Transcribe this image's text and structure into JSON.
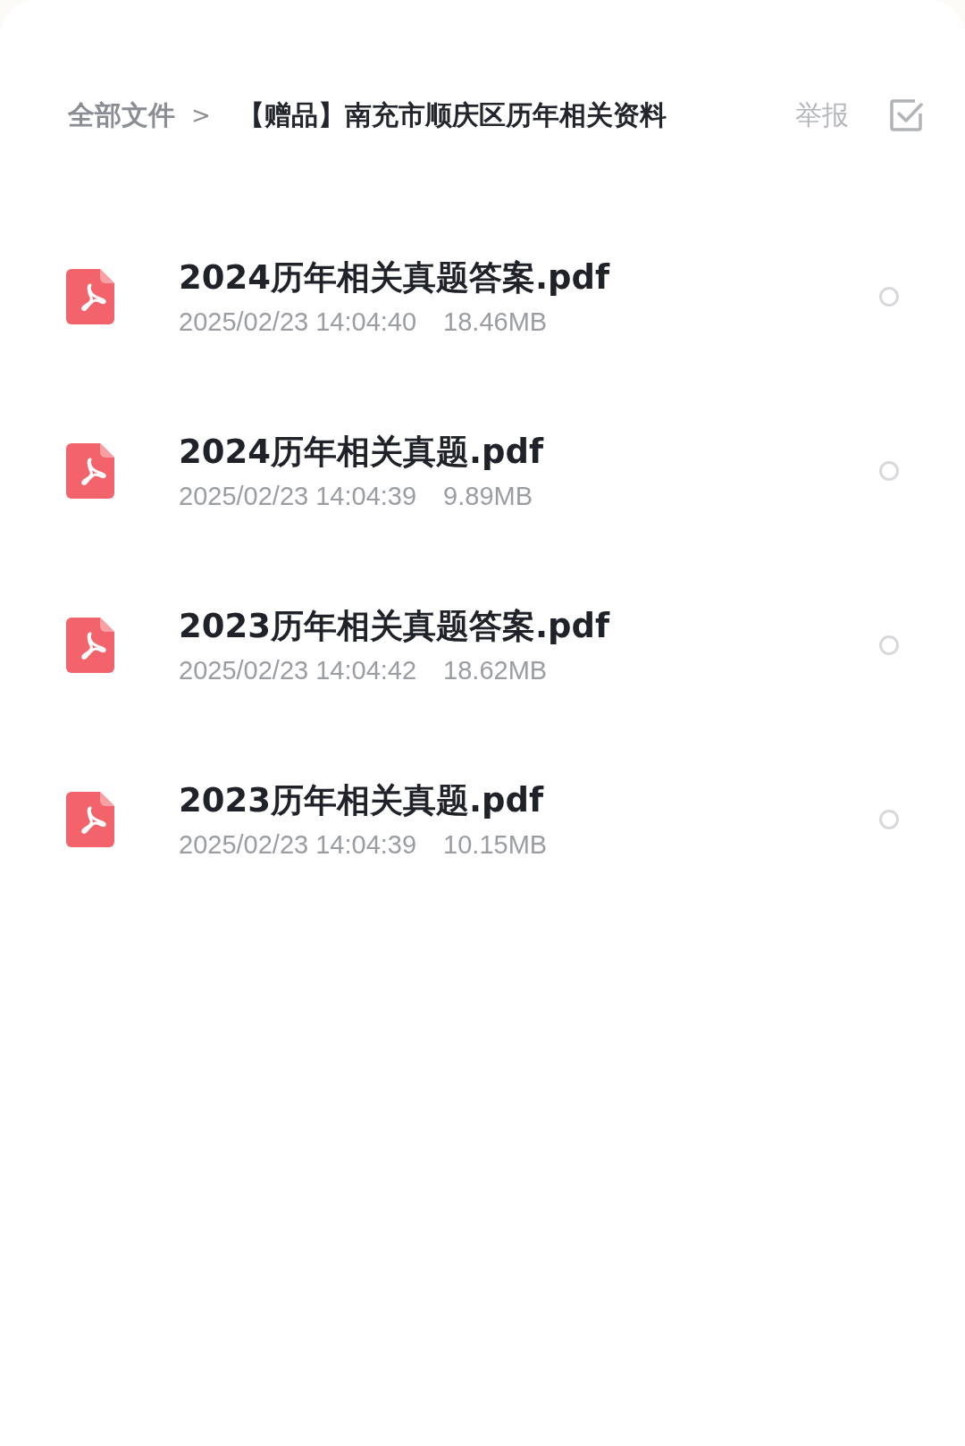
{
  "breadcrumb": {
    "root": "全部文件",
    "separator": ">",
    "current": "【赠品】南充市顺庆区历年相关资料"
  },
  "report_label": "举报",
  "files": [
    {
      "name": "2024历年相关真题答案.pdf",
      "date": "2025/02/23 14:04:40",
      "size": "18.46MB",
      "selected": false
    },
    {
      "name": "2024历年相关真题.pdf",
      "date": "2025/02/23 14:04:39",
      "size": "9.89MB",
      "selected": false
    },
    {
      "name": "2023历年相关真题答案.pdf",
      "date": "2025/02/23 14:04:42",
      "size": "18.62MB",
      "selected": false
    },
    {
      "name": "2023历年相关真题.pdf",
      "date": "2025/02/23 14:04:39",
      "size": "10.15MB",
      "selected": false
    }
  ]
}
